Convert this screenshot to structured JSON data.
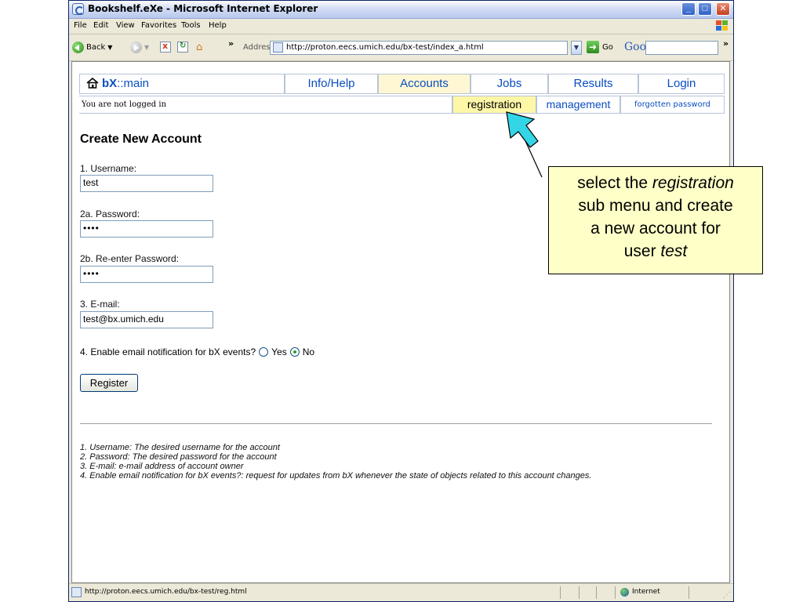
{
  "window": {
    "title": "Bookshelf.eXe - Microsoft Internet Explorer",
    "minimize_glyph": "_",
    "maximize_glyph": "□",
    "close_glyph": "✕"
  },
  "menu": [
    "File",
    "Edit",
    "View",
    "Favorites",
    "Tools",
    "Help"
  ],
  "toolbar": {
    "back_label": "Back",
    "chevron": "»",
    "address_label": "Address",
    "address_value": "http://proton.eecs.umich.edu/bx-test/index_a.html",
    "go_label": "Go",
    "google_label": "Google",
    "google_caret": "▾",
    "dropdown_glyph": "▼"
  },
  "site_nav": {
    "home_bold": "bX",
    "home_rest": "::main",
    "tabs": [
      "Info/Help",
      "Accounts",
      "Jobs",
      "Results",
      "Login"
    ],
    "active_tab": "Accounts",
    "status": "You are not logged in",
    "sub_tabs": [
      "registration",
      "management",
      "forgotten password"
    ],
    "active_sub_tab": "registration"
  },
  "form": {
    "heading": "Create New Account",
    "username_label": "1. Username:",
    "username_value": "test",
    "password_label": "2a. Password:",
    "password_value": "••••",
    "reenter_label": "2b. Re-enter Password:",
    "reenter_value": "••••",
    "email_label": "3. E-mail:",
    "email_value": "test@bx.umich.edu",
    "notify_label": "4. Enable email notification for bX events?",
    "notify_yes": "Yes",
    "notify_no": "No",
    "notify_selected": "No",
    "register_label": "Register"
  },
  "notes": [
    "1. Username: The desired username for the account",
    "2. Password: The desired password for the account",
    "3. E-mail: e-mail address of account owner",
    "4. Enable email notification for bX events?: request for updates from bX whenever the state of objects related to this account changes."
  ],
  "callout": {
    "line1_pre": "select the ",
    "line1_em": "registration",
    "line2": "sub menu and create",
    "line3": "a new account for",
    "line4_pre": "user ",
    "line4_em": "test"
  },
  "statusbar": {
    "url": "http://proton.eecs.umich.edu/bx-test/reg.html",
    "zone": "Internet"
  },
  "colors": {
    "link_blue": "#0a4dc0",
    "active_tab_bg": "#fff7d4",
    "active_subtab_bg": "#fff7a8",
    "callout_bg": "#ffffc8",
    "cursor_arrow": "#33d6e6"
  }
}
